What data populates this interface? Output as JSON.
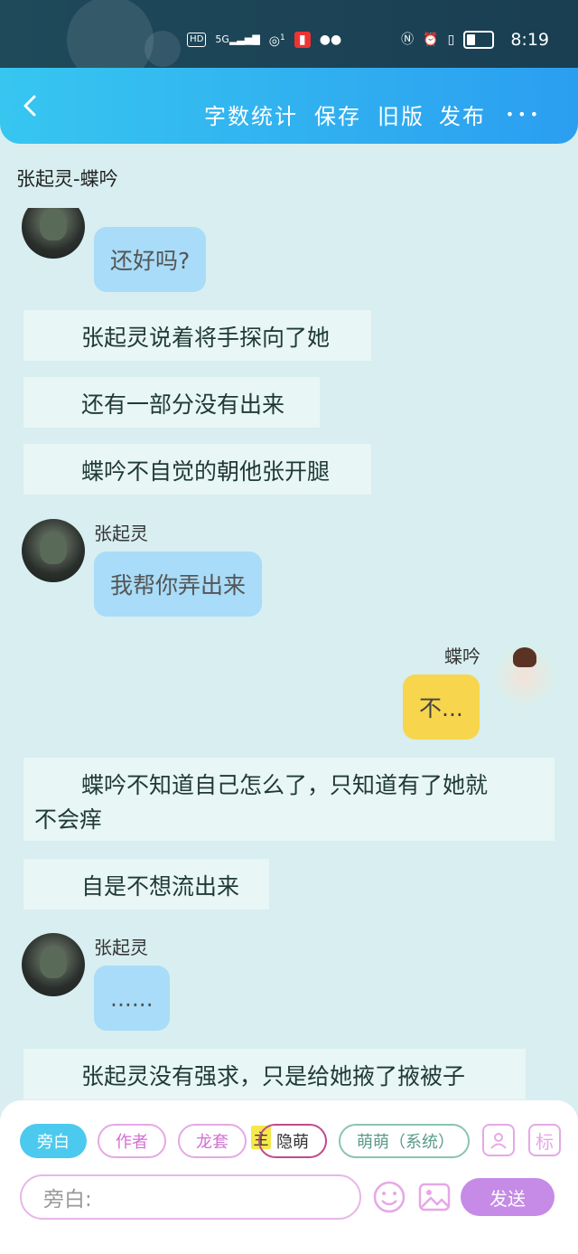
{
  "status_bar": {
    "hd": "HD",
    "net": "5G",
    "sim": "1",
    "time": "8:19"
  },
  "topbar": {
    "actions": [
      "字数统计",
      "保存",
      "旧版",
      "发布"
    ],
    "more": "•••"
  },
  "page_title": "张起灵-蝶吟",
  "chat": {
    "messages": [
      {
        "type": "bubble",
        "text": "还好吗?"
      },
      {
        "type": "narration",
        "text": "张起灵说着将手探向了她"
      },
      {
        "type": "narration",
        "text": "还有一部分没有出来"
      },
      {
        "type": "narration",
        "text": "蝶吟不自觉的朝他张开腿"
      },
      {
        "type": "bubble",
        "name": "张起灵",
        "text": "我帮你弄出来"
      },
      {
        "type": "bubble",
        "name": "蝶吟",
        "text": "不..."
      },
      {
        "type": "narration",
        "text_line1": "蝶吟不知道自己怎么了，只知道有了她就",
        "text_line2": "不会痒"
      },
      {
        "type": "narration",
        "text": "自是不想流出来"
      },
      {
        "type": "bubble",
        "name": "张起灵",
        "text": "......"
      },
      {
        "type": "narration",
        "text": "张起灵没有强求，只是给她掖了掖被子"
      }
    ]
  },
  "composer": {
    "chips": [
      "旁白",
      "作者",
      "龙套",
      "隐萌",
      "萌萌（系统）"
    ],
    "tag": "主",
    "mark": "标",
    "placeholder": "旁白:",
    "send": "发送"
  },
  "colors": {
    "accent": "#2b9ef0",
    "bubble_left": "#a8dcf8",
    "bubble_right": "#f7d64d",
    "send": "#c58be6"
  }
}
